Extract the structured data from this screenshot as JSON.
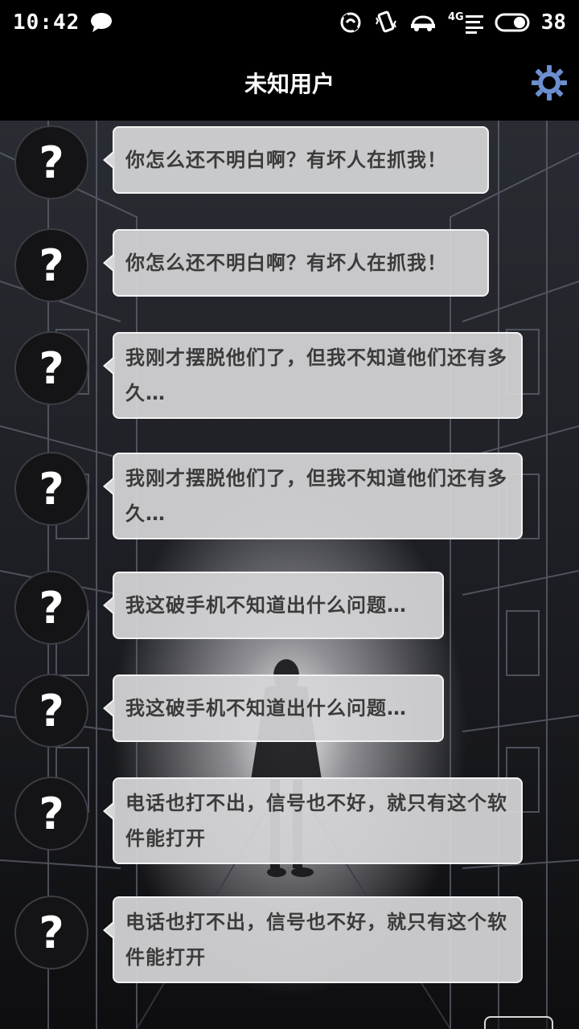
{
  "status_bar": {
    "time": "10:42",
    "network_label": "4G",
    "battery": "38",
    "icons": [
      "message-icon",
      "nfc-icon",
      "vibrate-icon",
      "car-icon",
      "signal-icon",
      "toggle-icon"
    ]
  },
  "header": {
    "title": "未知用户",
    "settings_icon": "gear-icon"
  },
  "messages": [
    {
      "avatar": "?",
      "text": "你怎么还不明白啊？有坏人在抓我！"
    },
    {
      "avatar": "?",
      "text": "你怎么还不明白啊？有坏人在抓我！"
    },
    {
      "avatar": "?",
      "text": "我刚才摆脱他们了，但我不知道他们还有多久…"
    },
    {
      "avatar": "?",
      "text": "我刚才摆脱他们了，但我不知道他们还有多久…"
    },
    {
      "avatar": "?",
      "text": "我这破手机不知道出什么问题…"
    },
    {
      "avatar": "?",
      "text": "我这破手机不知道出什么问题…"
    },
    {
      "avatar": "?",
      "text": "电话也打不出，信号也不好，就只有这个软件能打开"
    },
    {
      "avatar": "?",
      "text": "电话也打不出，信号也不好，就只有这个软件能打开"
    }
  ],
  "colors": {
    "bubble_bg": "#d5d5d7",
    "bubble_text": "#3b3b3b",
    "accent_gear": "#6d8fd0"
  }
}
